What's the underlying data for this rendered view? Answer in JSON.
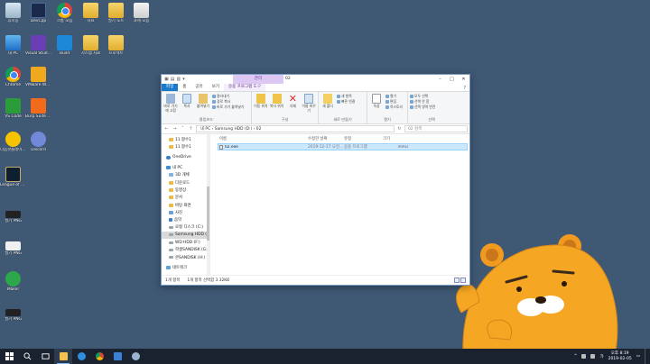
{
  "desktop_icons": [
    {
      "id": "recycle-bin",
      "label": "휴지통",
      "glyph": "g-bin",
      "col": 0,
      "row": 0
    },
    {
      "id": "this-pc",
      "label": "내 PC",
      "glyph": "g-pc",
      "col": 0,
      "row": 1
    },
    {
      "id": "chrome",
      "label": "Chrome",
      "glyph": "g-chrome",
      "col": 0,
      "row": 2
    },
    {
      "id": "vscode",
      "label": "VS Code",
      "glyph": "g-vsc",
      "col": 0,
      "row": 3
    },
    {
      "id": "potplayer",
      "label": "다음팟플레이어 64 비트",
      "glyph": "g-pot",
      "col": 0,
      "row": 4
    },
    {
      "id": "league",
      "label": "League of Legends",
      "glyph": "g-lol",
      "col": 0,
      "row": 5
    },
    {
      "id": "dark-shortcut",
      "label": "필기 PNG",
      "glyph": "g-dark",
      "col": 0,
      "row": 6
    },
    {
      "id": "white-shortcut",
      "label": "필기 PNG",
      "glyph": "g-white",
      "col": 0,
      "row": 7
    },
    {
      "id": "maker",
      "label": "Maker",
      "glyph": "g-green",
      "col": 0,
      "row": 8
    },
    {
      "id": "png-file",
      "label": "필기 PNG",
      "glyph": "g-dark",
      "col": 0,
      "row": 9
    },
    {
      "id": "devcpp",
      "label": "DevCpp",
      "glyph": "g-dev",
      "col": 1,
      "row": 0
    },
    {
      "id": "visual-studio",
      "label": "Visual Studio 2019",
      "glyph": "g-vs",
      "col": 1,
      "row": 1
    },
    {
      "id": "vmware",
      "label": "VMware Workstat",
      "glyph": "g-vm",
      "col": 1,
      "row": 2
    },
    {
      "id": "burp",
      "label": "Burp Suite Communi",
      "glyph": "g-burp",
      "col": 1,
      "row": 3
    },
    {
      "id": "discord",
      "label": "Discord",
      "glyph": "g-disc",
      "col": 1,
      "row": 4
    },
    {
      "id": "chrome-2",
      "label": "크롬 모음",
      "glyph": "g-chrome",
      "col": 2,
      "row": 0
    },
    {
      "id": "vsbuild",
      "label": "Build",
      "glyph": "g-vsblue",
      "col": 2,
      "row": 1
    },
    {
      "id": "folder-1",
      "label": "자료",
      "glyph": "g-folder",
      "col": 3,
      "row": 0
    },
    {
      "id": "folder-2",
      "label": "시스템 자료",
      "glyph": "g-folder",
      "col": 3,
      "row": 1
    },
    {
      "id": "folder-3",
      "label": "필기 노트",
      "glyph": "g-folder",
      "col": 4,
      "row": 0
    },
    {
      "id": "folder-4",
      "label": "프로젝트",
      "glyph": "g-folder",
      "col": 4,
      "row": 1
    },
    {
      "id": "folder-5",
      "label": "과제 모음",
      "glyph": "g-file",
      "col": 5,
      "row": 0
    }
  ],
  "explorer": {
    "title": "02",
    "context_tab_header": "관리",
    "tabs": [
      "파일",
      "홈",
      "공유",
      "보기",
      "응용 프로그램 도구"
    ],
    "ribbon": {
      "clipboard": {
        "name": "클립보드",
        "pin": "바로 가기에 고정",
        "copy": "복사",
        "paste": "붙여넣기",
        "cut": "잘라내기",
        "copy_path": "경로 복사",
        "paste_shortcut": "바로 가기 붙여넣기"
      },
      "organize": {
        "name": "구성",
        "move": "이동 위치",
        "copy_to": "복사 위치",
        "delete": "삭제",
        "rename": "이름 바꾸기"
      },
      "new": {
        "name": "새로 만들기",
        "new_folder": "새 폴더",
        "new_item": "새 항목",
        "easy_access": "빠른 연결"
      },
      "open": {
        "name": "열기",
        "properties": "속성",
        "open": "열기",
        "edit": "편집",
        "history": "히스토리"
      },
      "select": {
        "name": "선택",
        "all": "모두 선택",
        "none": "선택 안 함",
        "invert": "선택 영역 반전"
      }
    },
    "address": "내 PC  ›  Samsung HDD (D:)  ›  02",
    "search_placeholder": "02 검색",
    "nav_items": [
      {
        "label": "11.항수1",
        "icon": "folder",
        "level": "l1"
      },
      {
        "label": "11.항수1",
        "icon": "folder",
        "level": "l1"
      },
      {
        "label": "OneDrive",
        "icon": "cloud",
        "level": "l0",
        "gap": true
      },
      {
        "label": "내 PC",
        "icon": "pc",
        "level": "l0",
        "gap": true
      },
      {
        "label": "3D 개체",
        "icon": "obj",
        "level": "l1"
      },
      {
        "label": "다운로드",
        "icon": "folder",
        "level": "l1"
      },
      {
        "label": "동영상",
        "icon": "folder",
        "level": "l1"
      },
      {
        "label": "문서",
        "icon": "folder",
        "level": "l1"
      },
      {
        "label": "바탕 화면",
        "icon": "folder",
        "level": "l1"
      },
      {
        "label": "사진",
        "icon": "pic",
        "level": "l1"
      },
      {
        "label": "음악",
        "icon": "music",
        "level": "l1"
      },
      {
        "label": "로컬 디스크 (C:)",
        "icon": "drive",
        "level": "l1"
      },
      {
        "label": "Samsung HDD (D:)",
        "icon": "drive",
        "level": "l1",
        "selected": true
      },
      {
        "label": "WD HDD (F:)",
        "icon": "drive",
        "level": "l1"
      },
      {
        "label": "학생SANDISK (G:)",
        "icon": "drive",
        "level": "l1"
      },
      {
        "label": "콘SANDISK (H:)",
        "icon": "drive",
        "level": "l1"
      },
      {
        "label": "네트워크",
        "icon": "net",
        "level": "l0",
        "gap": true
      }
    ],
    "columns": {
      "name": "이름",
      "date": "수정한 날짜",
      "type": "유형",
      "size": "크기"
    },
    "files": [
      {
        "name": "02.exe",
        "date": "2019-12-17 오전...",
        "type": "응용 프로그램",
        "size": "46KB"
      }
    ],
    "status": {
      "count": "1개 항목",
      "selected": "1개 항목 선택함 3.32KB"
    }
  },
  "taskbar": {
    "items": [
      "start",
      "search",
      "task-view",
      "file-explorer",
      "edge",
      "chrome",
      "store",
      "app"
    ],
    "clock_time": "오후 8:19",
    "clock_date": "2019-02-05"
  }
}
